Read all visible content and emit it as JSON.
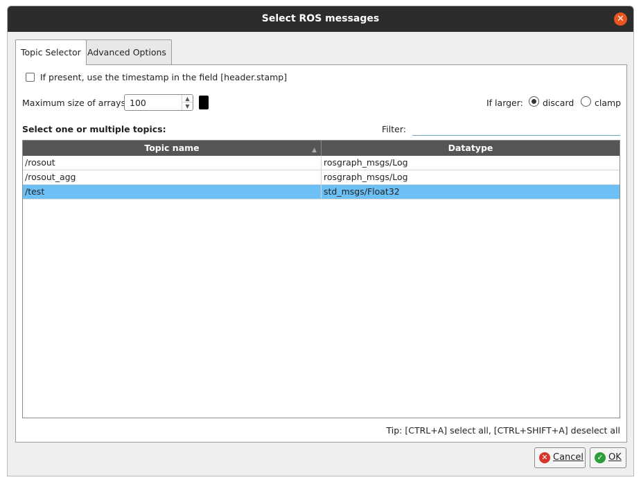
{
  "window": {
    "title": "Select ROS messages"
  },
  "tabs": [
    {
      "label": "Topic Selector",
      "active": true
    },
    {
      "label": "Advanced Options",
      "active": false
    }
  ],
  "options": {
    "use_timestamp_label": "If present, use the timestamp in the field [header.stamp]",
    "use_timestamp_checked": false,
    "max_array_label": "Maximum size of arrays:",
    "max_array_value": "100",
    "if_larger_label": "If larger:",
    "discard_label": "discard",
    "clamp_label": "clamp",
    "selected_mode": "discard"
  },
  "topics": {
    "heading": "Select one or multiple topics:",
    "filter_label": "Filter:",
    "filter_value": "",
    "columns": [
      "Topic name",
      "Datatype"
    ],
    "rows": [
      {
        "topic": "/rosout",
        "datatype": "rosgraph_msgs/Log",
        "selected": false
      },
      {
        "topic": "/rosout_agg",
        "datatype": "rosgraph_msgs/Log",
        "selected": false
      },
      {
        "topic": "/test",
        "datatype": "std_msgs/Float32",
        "selected": true
      }
    ],
    "tip": "Tip: [CTRL+A] select all, [CTRL+SHIFT+A] deselect all"
  },
  "buttons": {
    "cancel_label": "Cancel",
    "ok_label": "OK"
  },
  "colors": {
    "selection": "#6cc0f5",
    "close": "#e95420",
    "cancel_icon": "#d9362b",
    "ok_icon": "#2e9e3c"
  }
}
